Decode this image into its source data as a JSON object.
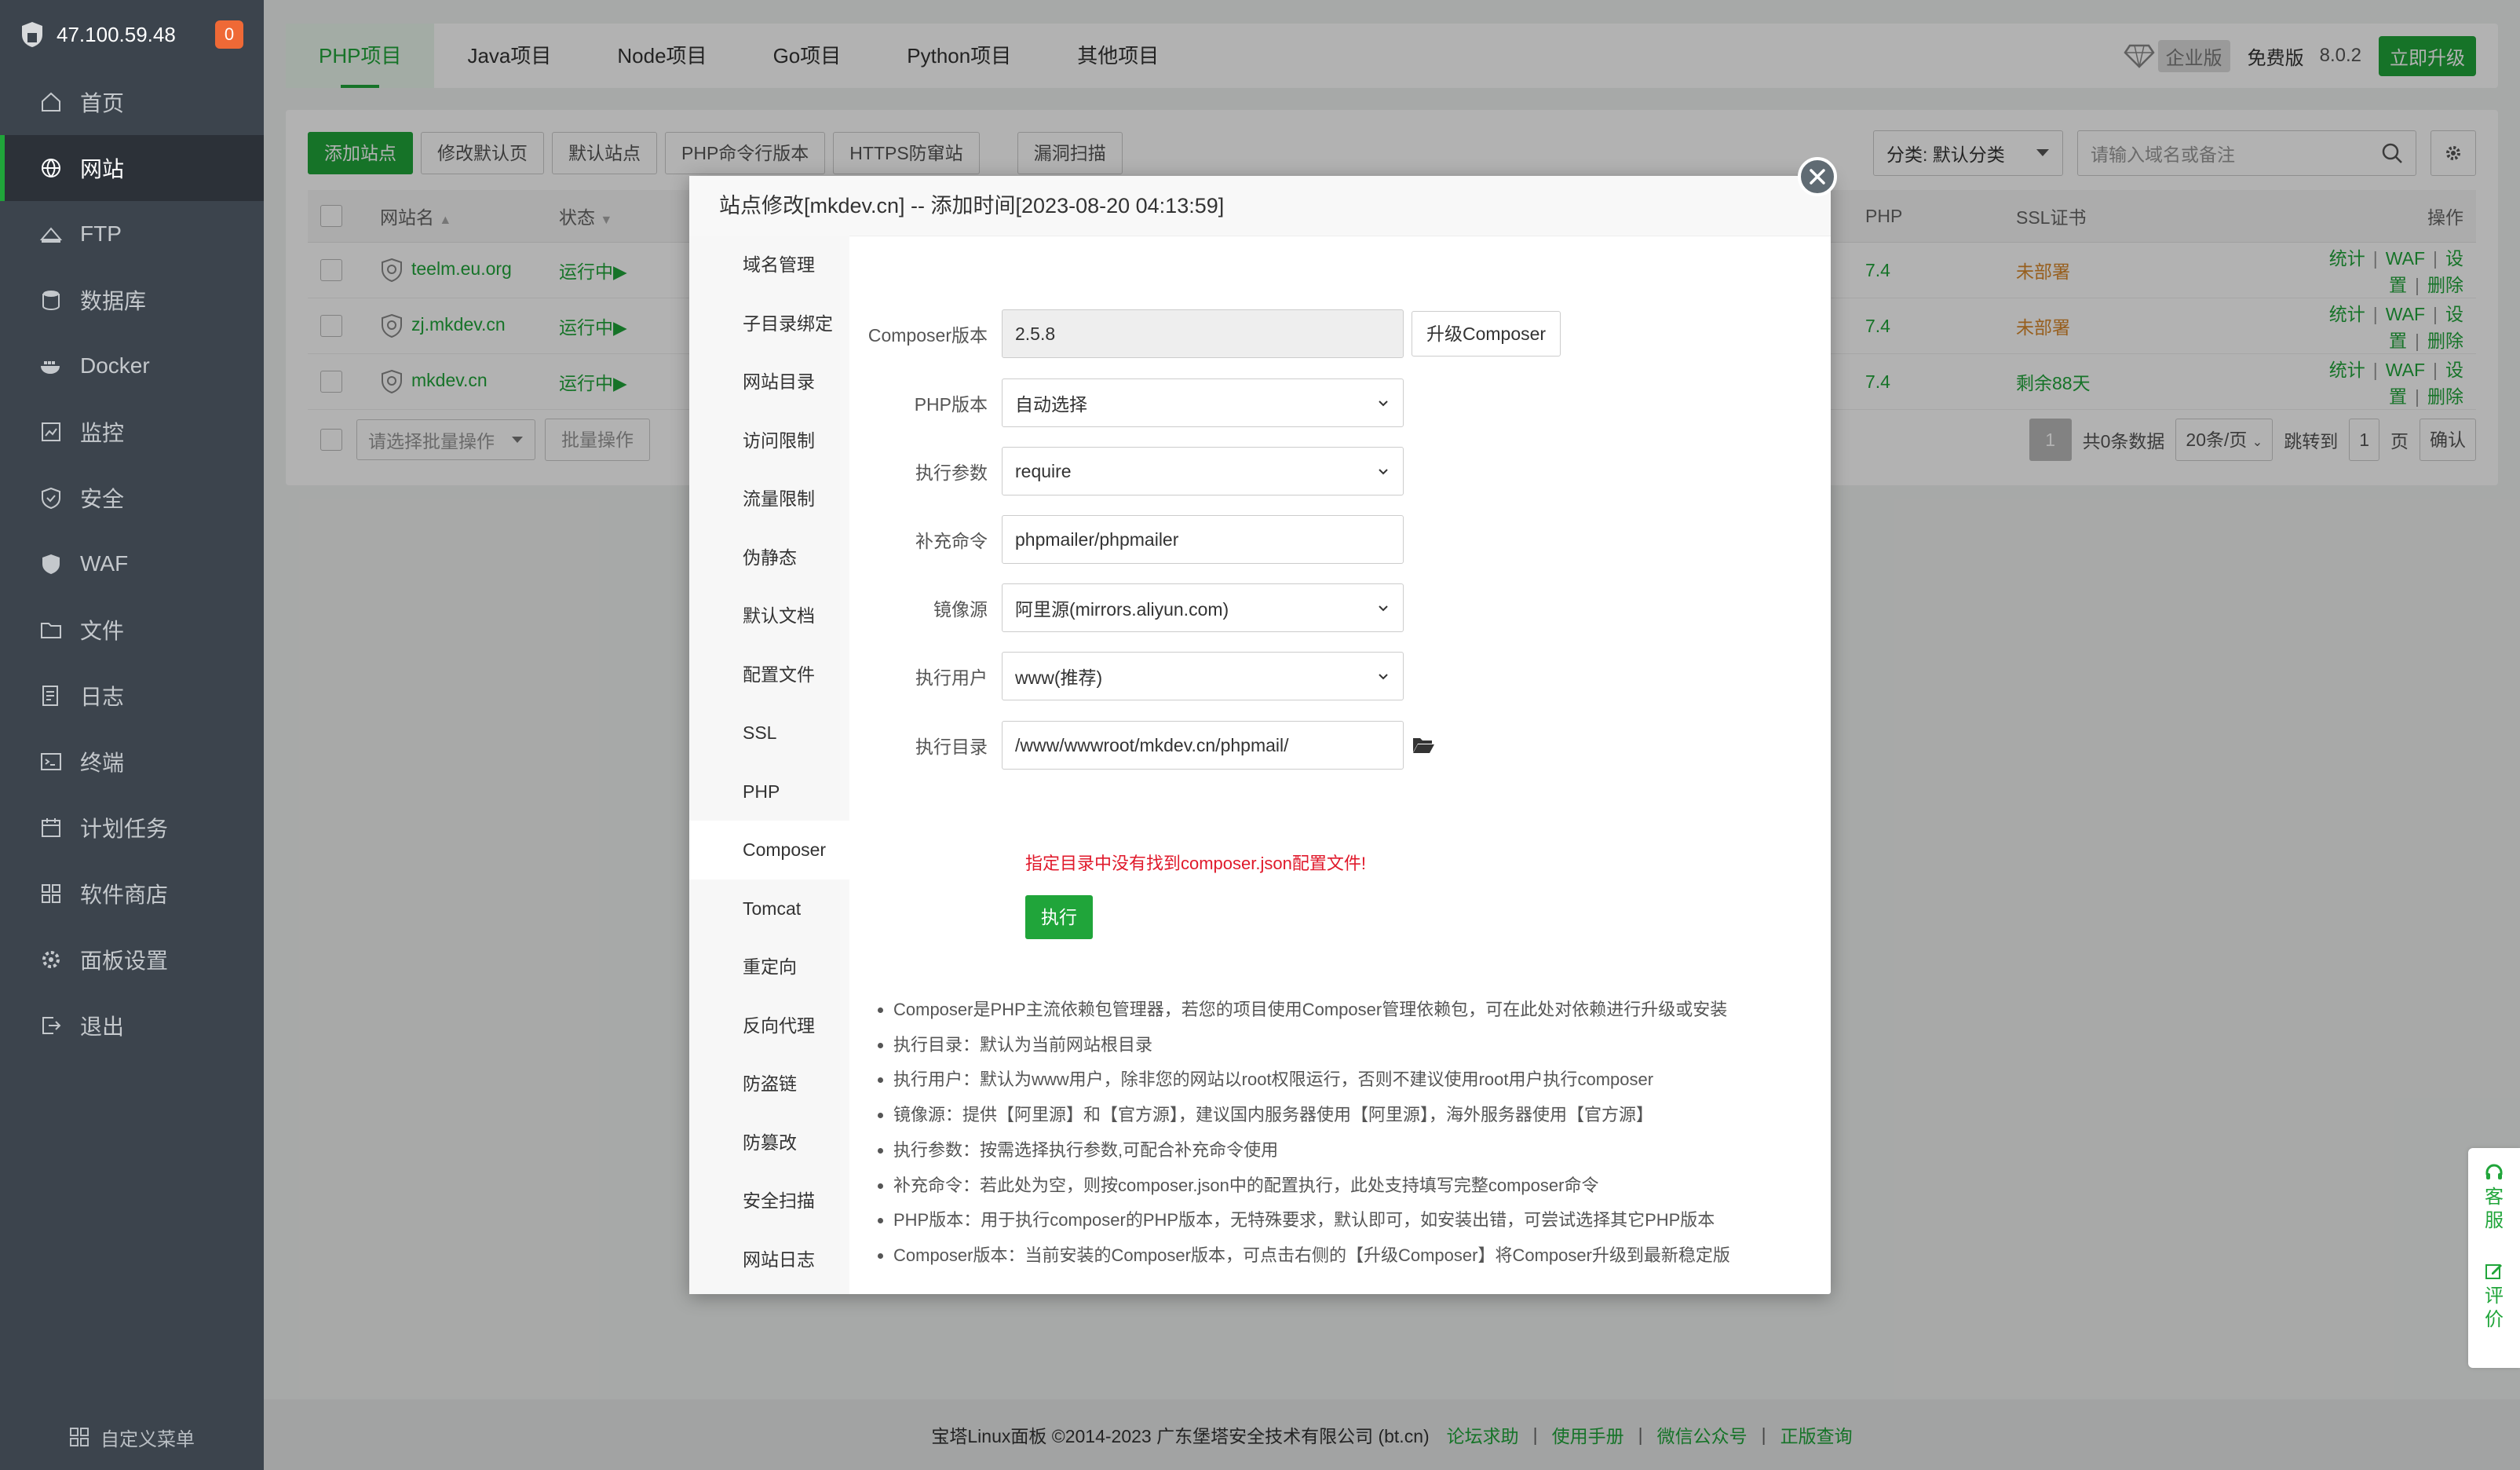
{
  "sidebar": {
    "ip": "47.100.59.48",
    "badge": "0",
    "items": [
      {
        "label": "首页",
        "icon": "home-icon"
      },
      {
        "label": "网站",
        "icon": "globe-icon"
      },
      {
        "label": "FTP",
        "icon": "ftp-icon"
      },
      {
        "label": "数据库",
        "icon": "database-icon"
      },
      {
        "label": "Docker",
        "icon": "docker-icon"
      },
      {
        "label": "监控",
        "icon": "monitor-icon"
      },
      {
        "label": "安全",
        "icon": "shield-check-icon"
      },
      {
        "label": "WAF",
        "icon": "waf-shield-icon"
      },
      {
        "label": "文件",
        "icon": "folder-icon"
      },
      {
        "label": "日志",
        "icon": "log-icon"
      },
      {
        "label": "终端",
        "icon": "terminal-icon"
      },
      {
        "label": "计划任务",
        "icon": "calendar-icon"
      },
      {
        "label": "软件商店",
        "icon": "apps-icon"
      },
      {
        "label": "面板设置",
        "icon": "settings-icon"
      },
      {
        "label": "退出",
        "icon": "logout-icon"
      }
    ],
    "custom_menu": "自定义菜单"
  },
  "topbar": {
    "tabs": [
      "PHP项目",
      "Java项目",
      "Node项目",
      "Go项目",
      "Python项目",
      "其他项目"
    ],
    "enterprise": "企业版",
    "free": "免费版",
    "version": "8.0.2",
    "upgrade": "立即升级"
  },
  "toolbar": {
    "buttons": [
      "添加站点",
      "修改默认页",
      "默认站点",
      "PHP命令行版本",
      "HTTPS防窜站"
    ],
    "scan": "漏洞扫描",
    "category": "分类: 默认分类",
    "search_placeholder": "请输入域名或备注"
  },
  "table": {
    "headers": {
      "name": "网站名",
      "status": "状态",
      "php": "PHP",
      "ssl": "SSL证书",
      "ops": "操作"
    },
    "rows": [
      {
        "name": "teelm.eu.org",
        "status": "运行中▶",
        "php": "7.4",
        "ssl": "未部署",
        "ssl_state": "none"
      },
      {
        "name": "zj.mkdev.cn",
        "status": "运行中▶",
        "php": "7.4",
        "ssl": "未部署",
        "ssl_state": "none"
      },
      {
        "name": "mkdev.cn",
        "status": "运行中▶",
        "php": "7.4",
        "ssl": "剩余88天",
        "ssl_state": "ok"
      }
    ],
    "ops": [
      "统计",
      "WAF",
      "设置",
      "删除"
    ],
    "batch_placeholder": "请选择批量操作",
    "batch_button": "批量操作",
    "pager": {
      "current": "1",
      "total": "共0条数据",
      "per_page": "20条/页",
      "jump": "跳转到",
      "page_input": "1",
      "page_unit": "页",
      "confirm": "确认"
    }
  },
  "dialog": {
    "title": "站点修改[mkdev.cn] -- 添加时间[2023-08-20 04:13:59]",
    "nav": [
      "域名管理",
      "子目录绑定",
      "网站目录",
      "访问限制",
      "流量限制",
      "伪静态",
      "默认文档",
      "配置文件",
      "SSL",
      "PHP",
      "Composer",
      "Tomcat",
      "重定向",
      "反向代理",
      "防盗链",
      "防篡改",
      "安全扫描",
      "网站日志"
    ],
    "active_nav": "Composer",
    "form": {
      "composer_version_label": "Composer版本",
      "composer_version": "2.5.8",
      "upgrade_button": "升级Composer",
      "php_version_label": "PHP版本",
      "php_version": "自动选择",
      "exec_param_label": "执行参数",
      "exec_param": "require",
      "extra_cmd_label": "补充命令",
      "extra_cmd": "phpmailer/phpmailer",
      "mirror_label": "镜像源",
      "mirror": "阿里源(mirrors.aliyun.com)",
      "exec_user_label": "执行用户",
      "exec_user": "www(推荐)",
      "exec_dir_label": "执行目录",
      "exec_dir": "/www/wwwroot/mkdev.cn/phpmail/",
      "error": "指定目录中没有找到composer.json配置文件!",
      "exec_button": "执行"
    },
    "tips": [
      "Composer是PHP主流依赖包管理器，若您的项目使用Composer管理依赖包，可在此处对依赖进行升级或安装",
      "执行目录：默认为当前网站根目录",
      "执行用户：默认为www用户，除非您的网站以root权限运行，否则不建议使用root用户执行composer",
      "镜像源：提供【阿里源】和【官方源】，建议国内服务器使用【阿里源】，海外服务器使用【官方源】",
      "执行参数：按需选择执行参数,可配合补充命令使用",
      "补充命令：若此处为空，则按composer.json中的配置执行，此处支持填写完整composer命令",
      "PHP版本：用于执行composer的PHP版本，无特殊要求，默认即可，如安装出错，可尝试选择其它PHP版本",
      "Composer版本：当前安装的Composer版本，可点击右侧的【升级Composer】将Composer升级到最新稳定版"
    ]
  },
  "footer": {
    "copyright": "宝塔Linux面板 ©2014-2023 广东堡塔安全技术有限公司 (bt.cn)",
    "links": [
      "论坛求助",
      "使用手册",
      "微信公众号",
      "正版查询"
    ]
  },
  "float": {
    "service": "客服",
    "review": "评价"
  },
  "colors": {
    "brand": "#20a53a",
    "sidebar": "#3c444d",
    "error": "#e0192b",
    "warning": "#d9892c"
  }
}
